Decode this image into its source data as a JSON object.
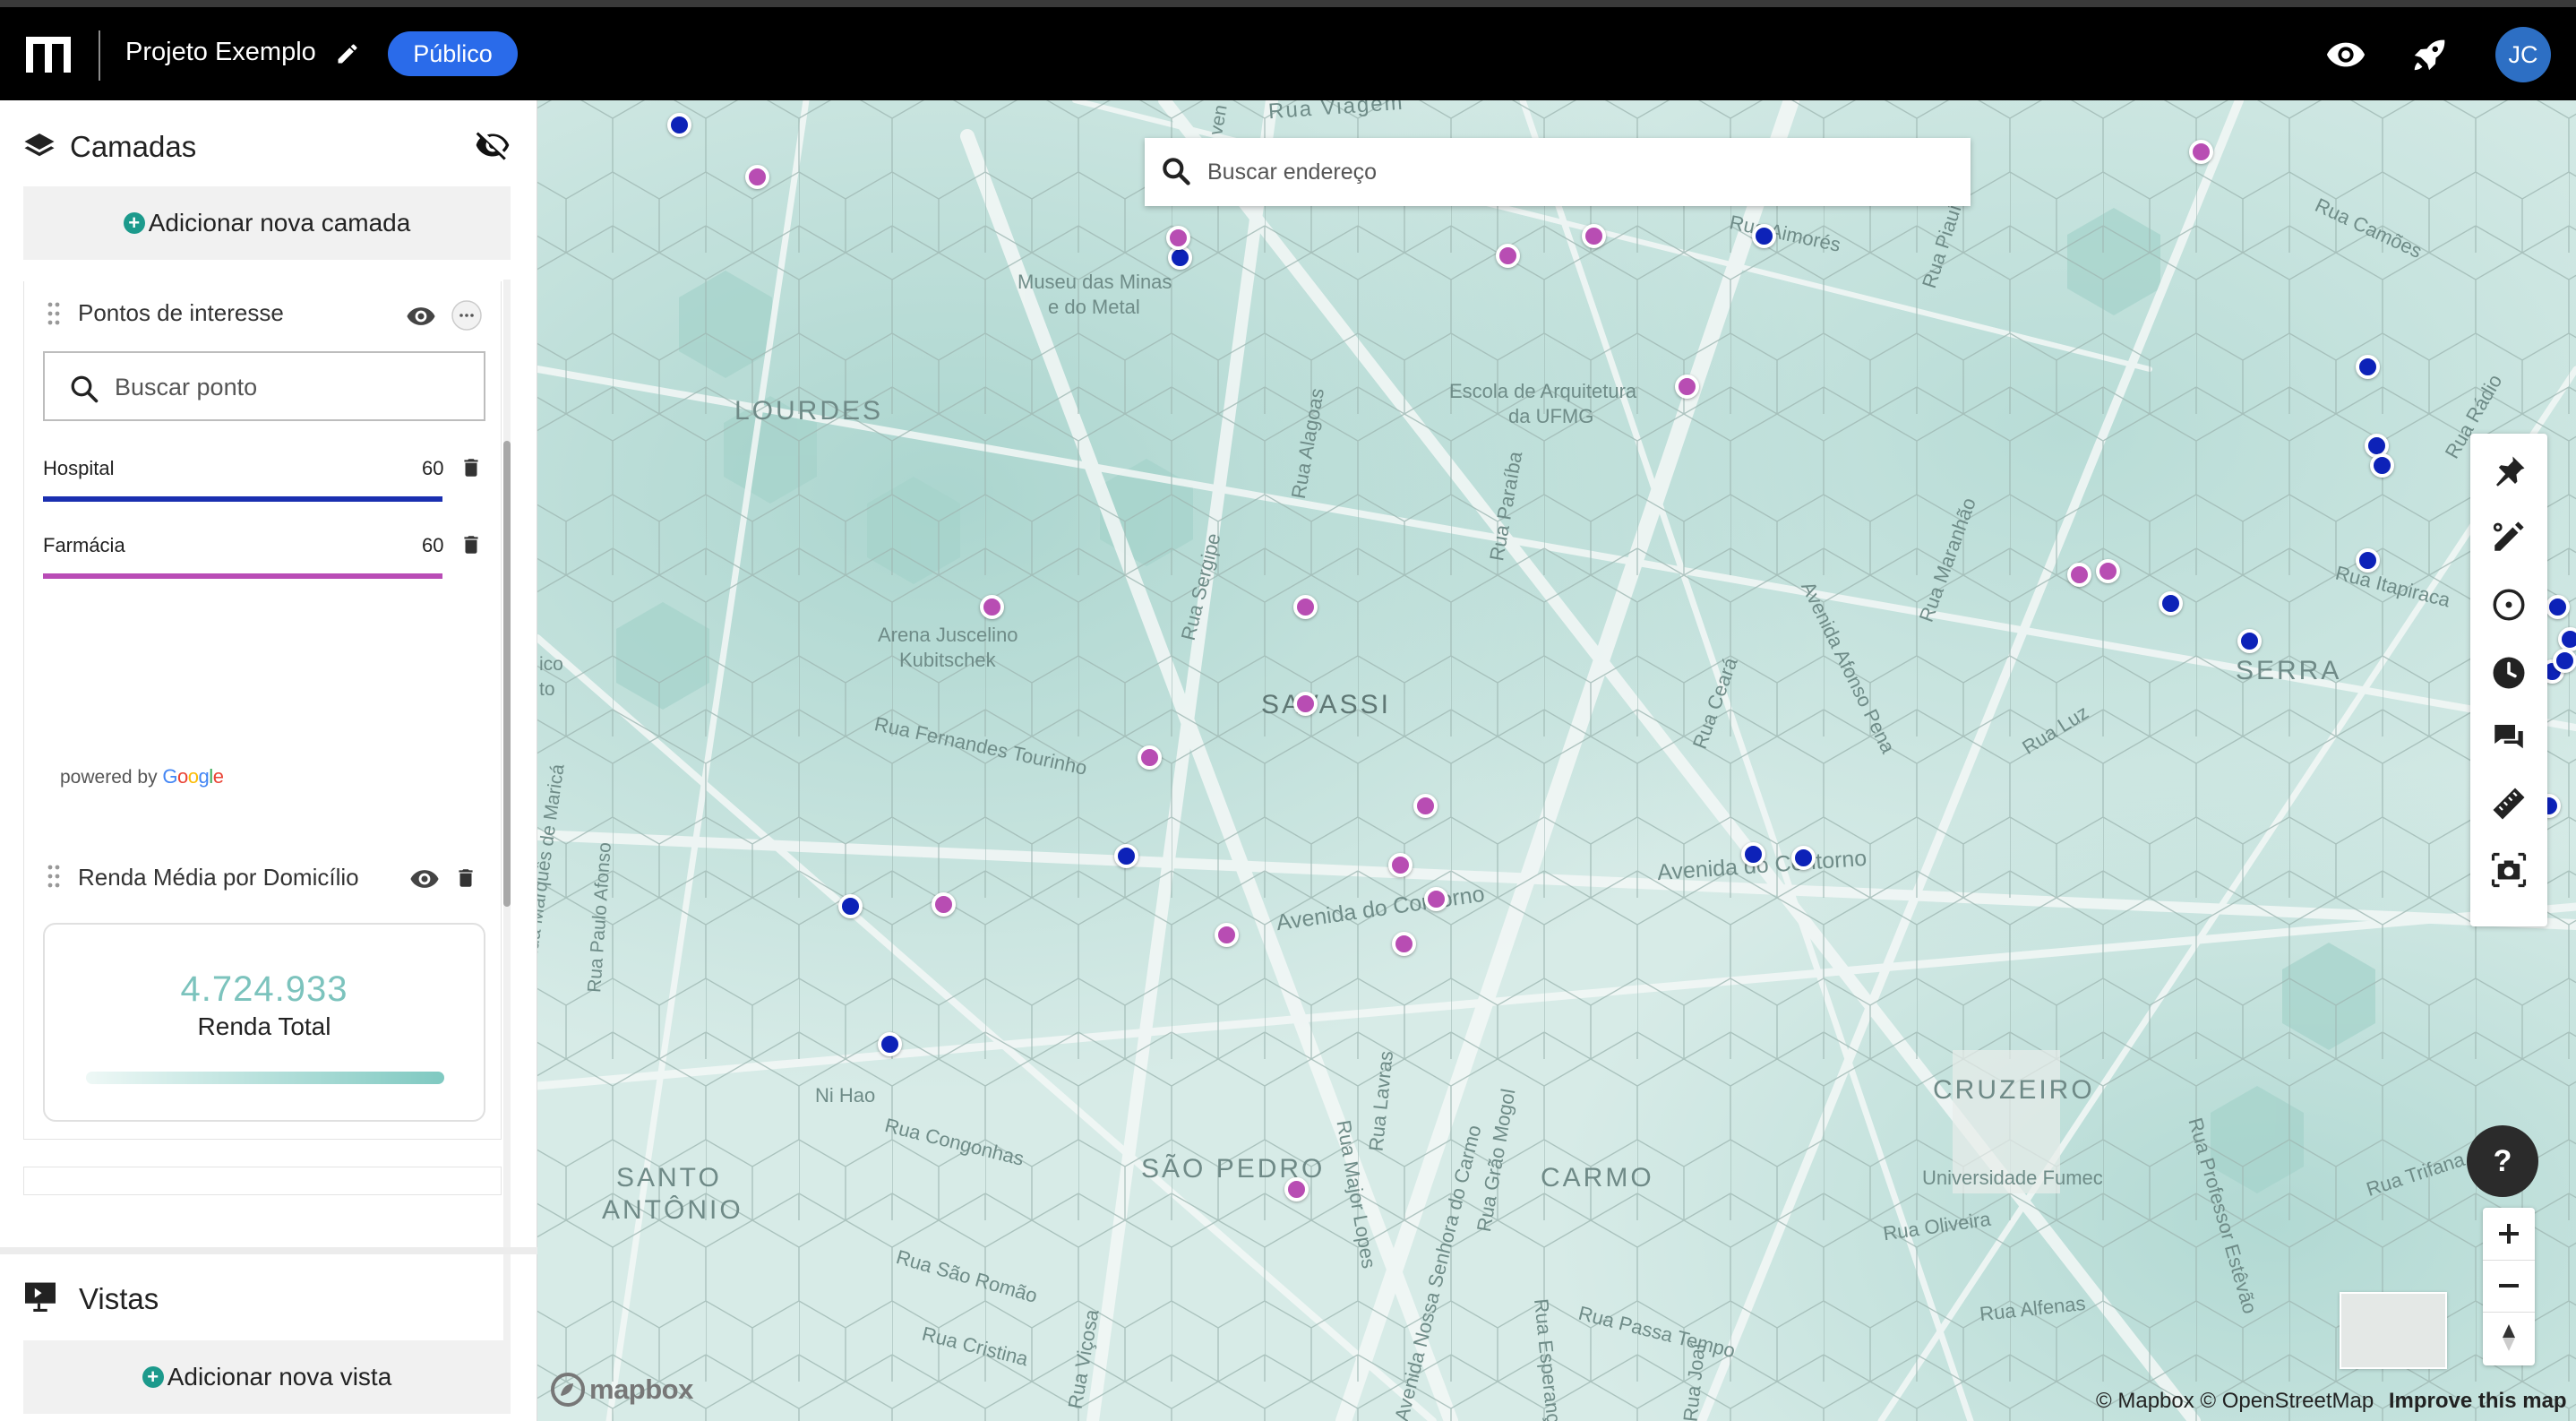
{
  "header": {
    "project_title": "Projeto Exemplo",
    "visibility_label": "Público",
    "user_initials": "JC"
  },
  "sidebar": {
    "layers_title": "Camadas",
    "add_layer_label": "Adicionar nova camada",
    "layers": [
      {
        "title": "Pontos de interesse",
        "search_placeholder": "Buscar ponto",
        "categories": [
          {
            "label": "Hospital",
            "count": "60",
            "color": "#1a2fb0"
          },
          {
            "label": "Farmácia",
            "count": "60",
            "color": "#b94cb6"
          }
        ],
        "powered_by": "powered by",
        "powered_brand": "Google"
      },
      {
        "title": "Renda Média por Domicílio",
        "kpi_value": "4.724.933",
        "kpi_label": "Renda Total"
      }
    ],
    "views_title": "Vistas",
    "add_view_label": "Adicionar nova vista"
  },
  "map": {
    "search_placeholder": "Buscar endereço",
    "districts": [
      "LOURDES",
      "SAVASSI",
      "SERRA",
      "CRUZEIRO",
      "CARMO",
      "SÃO PEDRO",
      "SANTO",
      "ANTÔNIO"
    ],
    "places": [
      "Museu das Minas",
      "e do Metal",
      "Escola de Arquitetura",
      "da UFMG",
      "Arena Juscelino",
      "Kubitschek",
      "Universidade Fumec",
      "Ni Hao"
    ],
    "streets": [
      "Rua Viagem",
      "Rua Aimorés",
      "Rua Piauí",
      "Rua Camões",
      "Rua Rádio",
      "Rua Alagoas",
      "Rua Paraíba",
      "Rua Sergipe",
      "Rua Maranhão",
      "Avenida Afonso Pena",
      "Rua Itapiraca",
      "Rua Ceará",
      "Rua Luz",
      "Rua Fernandes Tourinho",
      "Avenida do Contorno",
      "Avenida do Contorno",
      "Rua Marquês de Maricá",
      "Rua Paulo Afonso",
      "Rua Congonhas",
      "Rua Lavras",
      "Rua Major Lopes",
      "Avenida Nossa Senhora do Carmo",
      "Rua Grão Mogol",
      "Rua Oliveira",
      "Rua Trifana",
      "Rua Professor Estêvão",
      "Rua Alfenas",
      "Rua Passa Tempo",
      "Rua São Romão",
      "Rua Cristina",
      "Rua Viçosa",
      "Rua Esperança",
      "Rua Joaí"
    ],
    "edge_fragments": [
      "ico",
      "to",
      "ven"
    ],
    "poi_colors": {
      "hospital": "#0d22b8",
      "farmacia": "#b84db3"
    },
    "attribution": "© Mapbox © OpenStreetMap",
    "improve_link": "Improve this map",
    "mapbox_label": "mapbox",
    "help_label": "?"
  }
}
